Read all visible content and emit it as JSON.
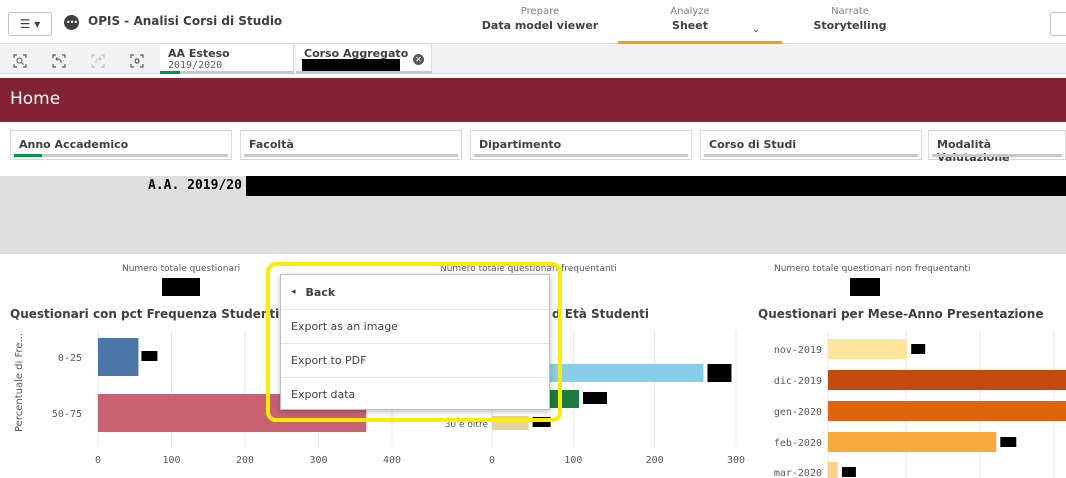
{
  "topbar": {
    "menu_glyph": "☰ ▾",
    "app_icon": "•••",
    "app_title": "OPIS - Analisi Corsi di Studio",
    "tabs": [
      {
        "sub": "Prepare",
        "main": "Data model viewer"
      },
      {
        "sub": "Analyze",
        "main": "Sheet"
      },
      {
        "sub": "Narrate",
        "main": "Storytelling"
      }
    ],
    "active_tab": "Sheet",
    "accent_color": "#f39c12"
  },
  "selection_bar": {
    "icons": [
      "smart-search-icon",
      "step-back-icon",
      "step-forward-icon",
      "clear-selections-icon"
    ],
    "chips": [
      {
        "label": "AA Esteso",
        "value": "2019/2020"
      },
      {
        "label": "Corso Aggregato",
        "value": ""
      }
    ]
  },
  "sheet": {
    "title": "Home",
    "band_color": "#832232"
  },
  "filters": [
    {
      "label": "Anno Accademico"
    },
    {
      "label": "Facoltà"
    },
    {
      "label": "Dipartimento"
    },
    {
      "label": "Corso di Studi"
    },
    {
      "label": "Modalità Valutazione"
    }
  ],
  "banner": {
    "text": "A.A. 2019/20 -"
  },
  "kpis": [
    {
      "label": "Numero totale questionari"
    },
    {
      "label": "Numero totale questionari frequentanti"
    },
    {
      "label": "Numero totale questionari non frequentanti"
    }
  ],
  "charts": {
    "left_title": "Questionari con pct Frequenza Studenti",
    "middle_title": "d  Età Studenti",
    "right_title": "Questionari per Mese-Anno Presentazione"
  },
  "chart_data": [
    {
      "type": "bar",
      "orientation": "horizontal",
      "title": "Questionari con pct Frequenza Studenti",
      "ylabel": "Percentuale di Fre...",
      "categories": [
        "0-25",
        "50-75"
      ],
      "values": [
        55,
        365
      ],
      "xlim": [
        0,
        400
      ],
      "xticks": [
        "0",
        "100",
        "200",
        "300",
        "400"
      ],
      "colors": [
        "#4a77a8",
        "#c86272"
      ]
    },
    {
      "type": "bar",
      "orientation": "horizontal",
      "title": "d  Età Studenti",
      "categories": [
        "",
        "",
        "30 e oltre"
      ],
      "values": [
        260,
        107,
        45
      ],
      "xlim": [
        0,
        300
      ],
      "xticks": [
        "0",
        "100",
        "200",
        "300"
      ],
      "colors": [
        "#87ceeb",
        "#1d7a3e",
        "#e3d59a"
      ]
    },
    {
      "type": "bar",
      "orientation": "horizontal",
      "title": "Questionari per Mese-Anno Presentazione",
      "categories": [
        "nov-2019",
        "dic-2019",
        "gen-2020",
        "feb-2020",
        "mar-2020"
      ],
      "values": [
        80,
        280,
        280,
        170,
        10
      ],
      "colors": [
        "#fde59b",
        "#c24a0e",
        "#e0640e",
        "#f8a93d",
        "#fcd08a"
      ]
    }
  ],
  "context_menu": {
    "back_glyph": "◂",
    "back_label": "Back",
    "items": [
      "Export as an image",
      "Export to PDF",
      "Export data"
    ]
  }
}
